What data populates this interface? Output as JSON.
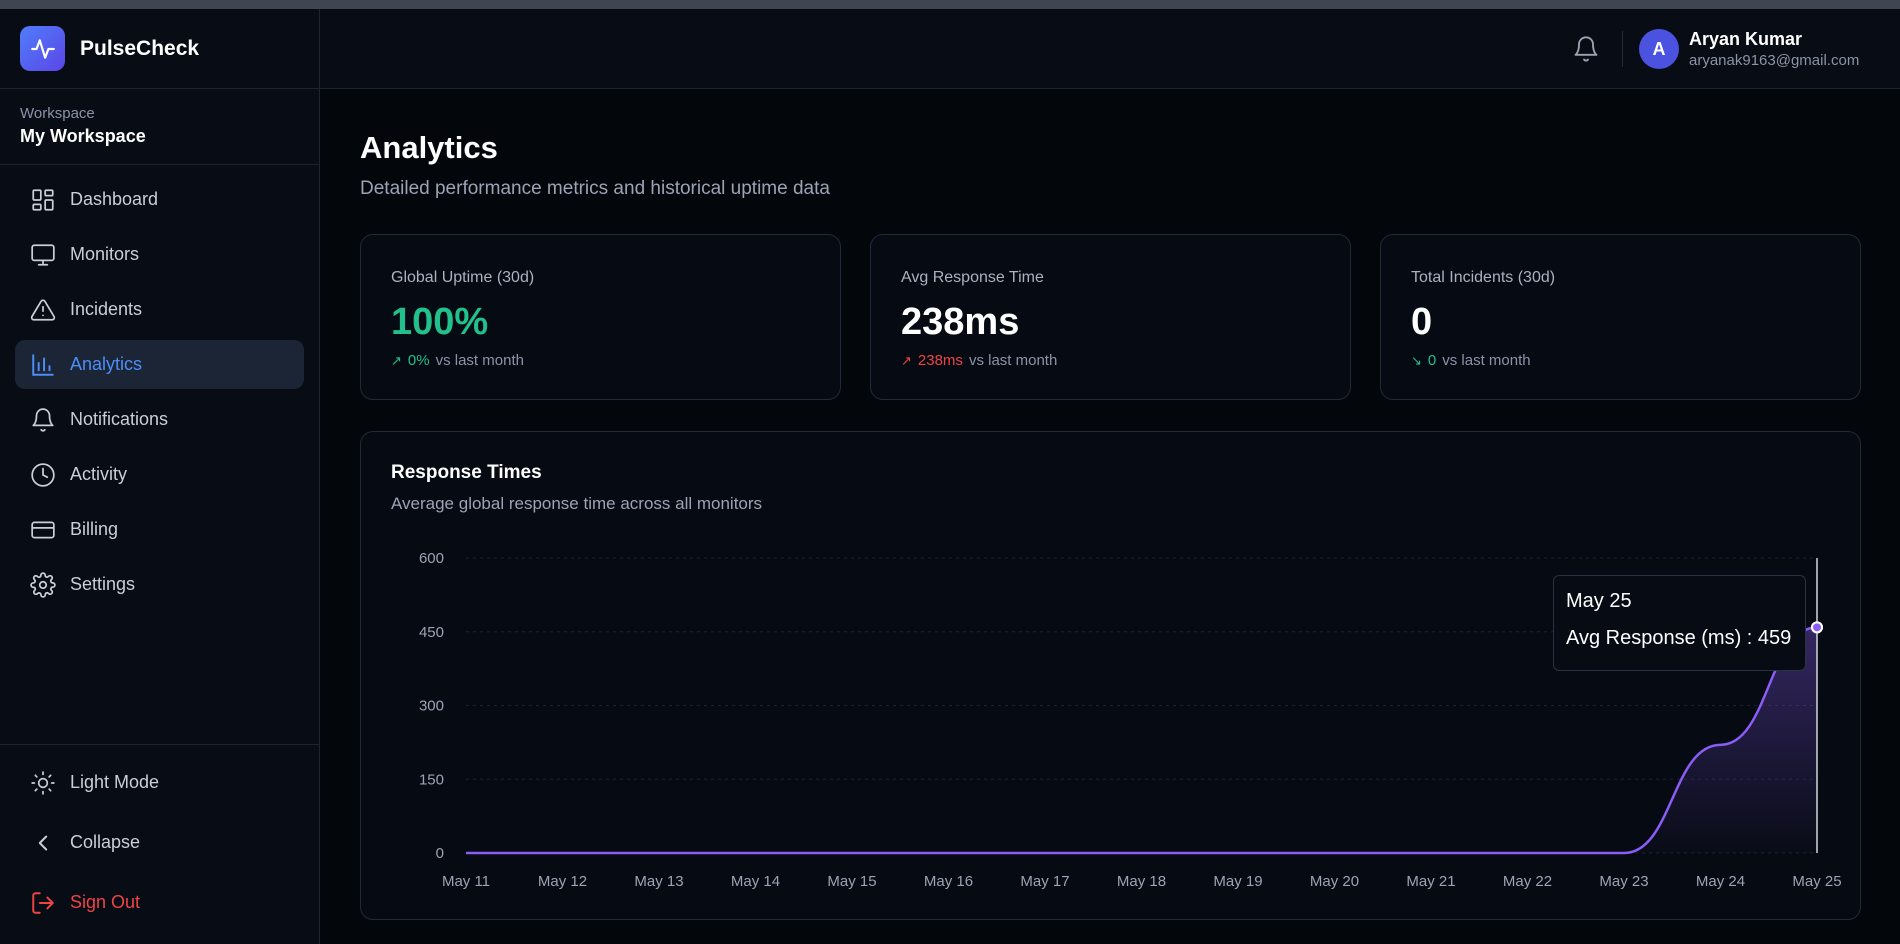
{
  "app": {
    "name": "PulseCheck"
  },
  "workspace": {
    "label": "Workspace",
    "name": "My Workspace"
  },
  "nav": [
    {
      "label": "Dashboard",
      "icon": "dashboard-icon"
    },
    {
      "label": "Monitors",
      "icon": "monitor-icon"
    },
    {
      "label": "Incidents",
      "icon": "alert-triangle-icon"
    },
    {
      "label": "Analytics",
      "icon": "bar-chart-icon",
      "active": true
    },
    {
      "label": "Notifications",
      "icon": "bell-icon"
    },
    {
      "label": "Activity",
      "icon": "clock-icon"
    },
    {
      "label": "Billing",
      "icon": "credit-card-icon"
    },
    {
      "label": "Settings",
      "icon": "gear-icon"
    }
  ],
  "sidebar_bottom": {
    "light_mode": "Light Mode",
    "collapse": "Collapse",
    "sign_out": "Sign Out"
  },
  "user": {
    "initial": "A",
    "name": "Aryan Kumar",
    "email": "aryanak9163@gmail.com"
  },
  "page": {
    "title": "Analytics",
    "subtitle": "Detailed performance metrics and historical uptime data"
  },
  "stats": [
    {
      "label": "Global Uptime (30d)",
      "value": "100%",
      "delta": "0%",
      "delta_suffix": "vs last month",
      "trend": "up"
    },
    {
      "label": "Avg Response Time",
      "value": "238ms",
      "delta": "238ms",
      "delta_suffix": "vs last month",
      "trend": "up"
    },
    {
      "label": "Total Incidents (30d)",
      "value": "0",
      "delta": "0",
      "delta_suffix": "vs last month",
      "trend": "down"
    }
  ],
  "chart": {
    "title": "Response Times",
    "subtitle": "Average global response time across all monitors",
    "tooltip": {
      "date": "May 25",
      "label": "Avg Response (ms) : 459"
    }
  },
  "chart_data": {
    "type": "area",
    "title": "Response Times",
    "x": [
      "May 11",
      "May 12",
      "May 13",
      "May 14",
      "May 15",
      "May 16",
      "May 17",
      "May 18",
      "May 19",
      "May 20",
      "May 21",
      "May 22",
      "May 23",
      "May 24",
      "May 25"
    ],
    "series": [
      {
        "values": [
          0,
          0,
          0,
          0,
          0,
          0,
          0,
          0,
          0,
          0,
          0,
          0,
          0,
          220,
          459
        ]
      }
    ],
    "yticks": [
      0,
      150,
      300,
      450,
      600
    ],
    "ylim": [
      0,
      600
    ],
    "grid": true,
    "color": "#8b5cf6"
  },
  "colors": {
    "accent": "#4d8df7",
    "success": "#22c08a",
    "danger": "#ef4444",
    "series": "#8b5cf6"
  }
}
